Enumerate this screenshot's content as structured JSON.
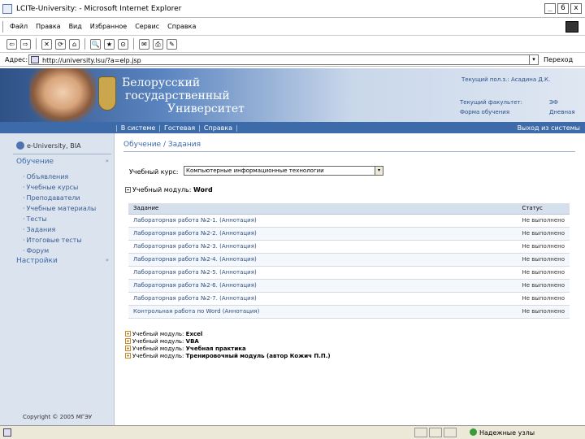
{
  "window": {
    "title": "LCITe-University: - Microsoft Internet Explorer",
    "buttons": [
      "_",
      "6",
      "x"
    ]
  },
  "menu": {
    "items": [
      "Файл",
      "Правка",
      "Вид",
      "Избранное",
      "Сервис",
      "Справка"
    ]
  },
  "toolbar": {
    "tools": [
      "⇦",
      "⇨",
      "✕",
      "⟳",
      "⌂",
      "🔍",
      "★",
      "⊙",
      "✉",
      "⎙",
      "✎"
    ]
  },
  "address": {
    "label": "Адрес:",
    "url": "http://university.lsu/?a=elp.jsp",
    "go_label": "Переход"
  },
  "banner": {
    "line1": "Белорусский",
    "line2": "государственный",
    "line3": "Университет",
    "user_label": "Текущий пол.з.: Асадина Д.К.",
    "faculty_label": "Текущий факультет:",
    "faculty_value": "ЭФ",
    "form_label": "Форма обучения",
    "form_value": "Дневная"
  },
  "nav": {
    "links": [
      "В системе",
      "Гостевая",
      "Справка"
    ],
    "separator": "|",
    "logout": "Выход из системы"
  },
  "sidebar": {
    "brand": "e-University, BIA",
    "section1": "Обучение",
    "items": [
      "Объявления",
      "Учебные курсы",
      "Преподаватели",
      "Учебные материалы",
      "Тесты",
      "Задания",
      "Итоговые тесты",
      "Форум"
    ],
    "section2": "Настройки",
    "collapse_arrow": "»",
    "copyright": "Copyright © 2005 МГЭУ"
  },
  "main": {
    "breadcrumb": "Обучение / Задания",
    "course_label": "Учебный курс:",
    "course_value": "Компьютерные информационные технологии",
    "select_arrow": "▾",
    "module_label": "Учебный модуль:",
    "module_value": "Word",
    "table": {
      "headers": [
        "Задание",
        "Статус"
      ],
      "rows": [
        {
          "task": "Лабораторная работа №2-1.",
          "note": "(Аннотация)",
          "status": "Не выполнено"
        },
        {
          "task": "Лабораторная работа №2-2.",
          "note": "(Аннотация)",
          "status": "Не выполнено"
        },
        {
          "task": "Лабораторная работа №2-3.",
          "note": "(Аннотация)",
          "status": "Не выполнено"
        },
        {
          "task": "Лабораторная работа №2-4.",
          "note": "(Аннотация)",
          "status": "Не выполнено"
        },
        {
          "task": "Лабораторная работа №2-5.",
          "note": "(Аннотация)",
          "status": "Не выполнено"
        },
        {
          "task": "Лабораторная работа №2-6.",
          "note": "(Аннотация)",
          "status": "Не выполнено"
        },
        {
          "task": "Лабораторная работа №2-7.",
          "note": "(Аннотация)",
          "status": "Не выполнено"
        },
        {
          "task": "Контрольная работа по Word",
          "note": "(Аннотация)",
          "status": "Не выполнено"
        }
      ]
    },
    "other_modules": [
      {
        "label": "Учебный модуль:",
        "value": "Excel"
      },
      {
        "label": "Учебный модуль:",
        "value": "VBA"
      },
      {
        "label": "Учебный модуль:",
        "value": "Учебная практика"
      },
      {
        "label": "Учебный модуль:",
        "value": "Тренировочный модуль (автор Кожич П.П.)"
      }
    ]
  },
  "status": {
    "zone": "Надежные узлы"
  }
}
